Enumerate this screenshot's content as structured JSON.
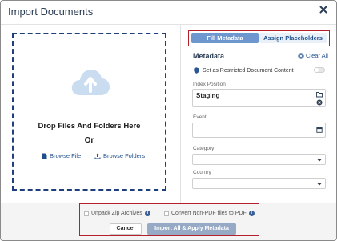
{
  "dialog": {
    "title": "Import Documents"
  },
  "dropzone": {
    "main_text": "Drop Files And Folders Here",
    "or_text": "Or",
    "browse_file": "Browse File",
    "browse_folders": "Browse Folders"
  },
  "tabs": [
    {
      "label": "Fill Metadata",
      "active": true
    },
    {
      "label": "Assign Placeholders",
      "active": false
    }
  ],
  "metadata": {
    "title": "Metadata",
    "clear_all": "Clear All",
    "restricted_label": "Set as Restricted Document Content",
    "restricted_on": false,
    "fields": {
      "index_position": {
        "label": "Index Position",
        "value": "Staging"
      },
      "event": {
        "label": "Event",
        "value": ""
      },
      "category": {
        "label": "Category",
        "value": ""
      },
      "country": {
        "label": "Country",
        "value": ""
      }
    }
  },
  "footer": {
    "unpack_zip": "Unpack Zip Archives",
    "convert_pdf": "Convert Non-PDF files to PDF",
    "cancel": "Cancel",
    "import": "Import All & Apply Metadata"
  },
  "colors": {
    "accent": "#6f97cf",
    "highlight_border": "#b6202b",
    "link": "#1f4f8b",
    "import_button": "#96a9c5",
    "cloud": "#c9dcf0"
  }
}
